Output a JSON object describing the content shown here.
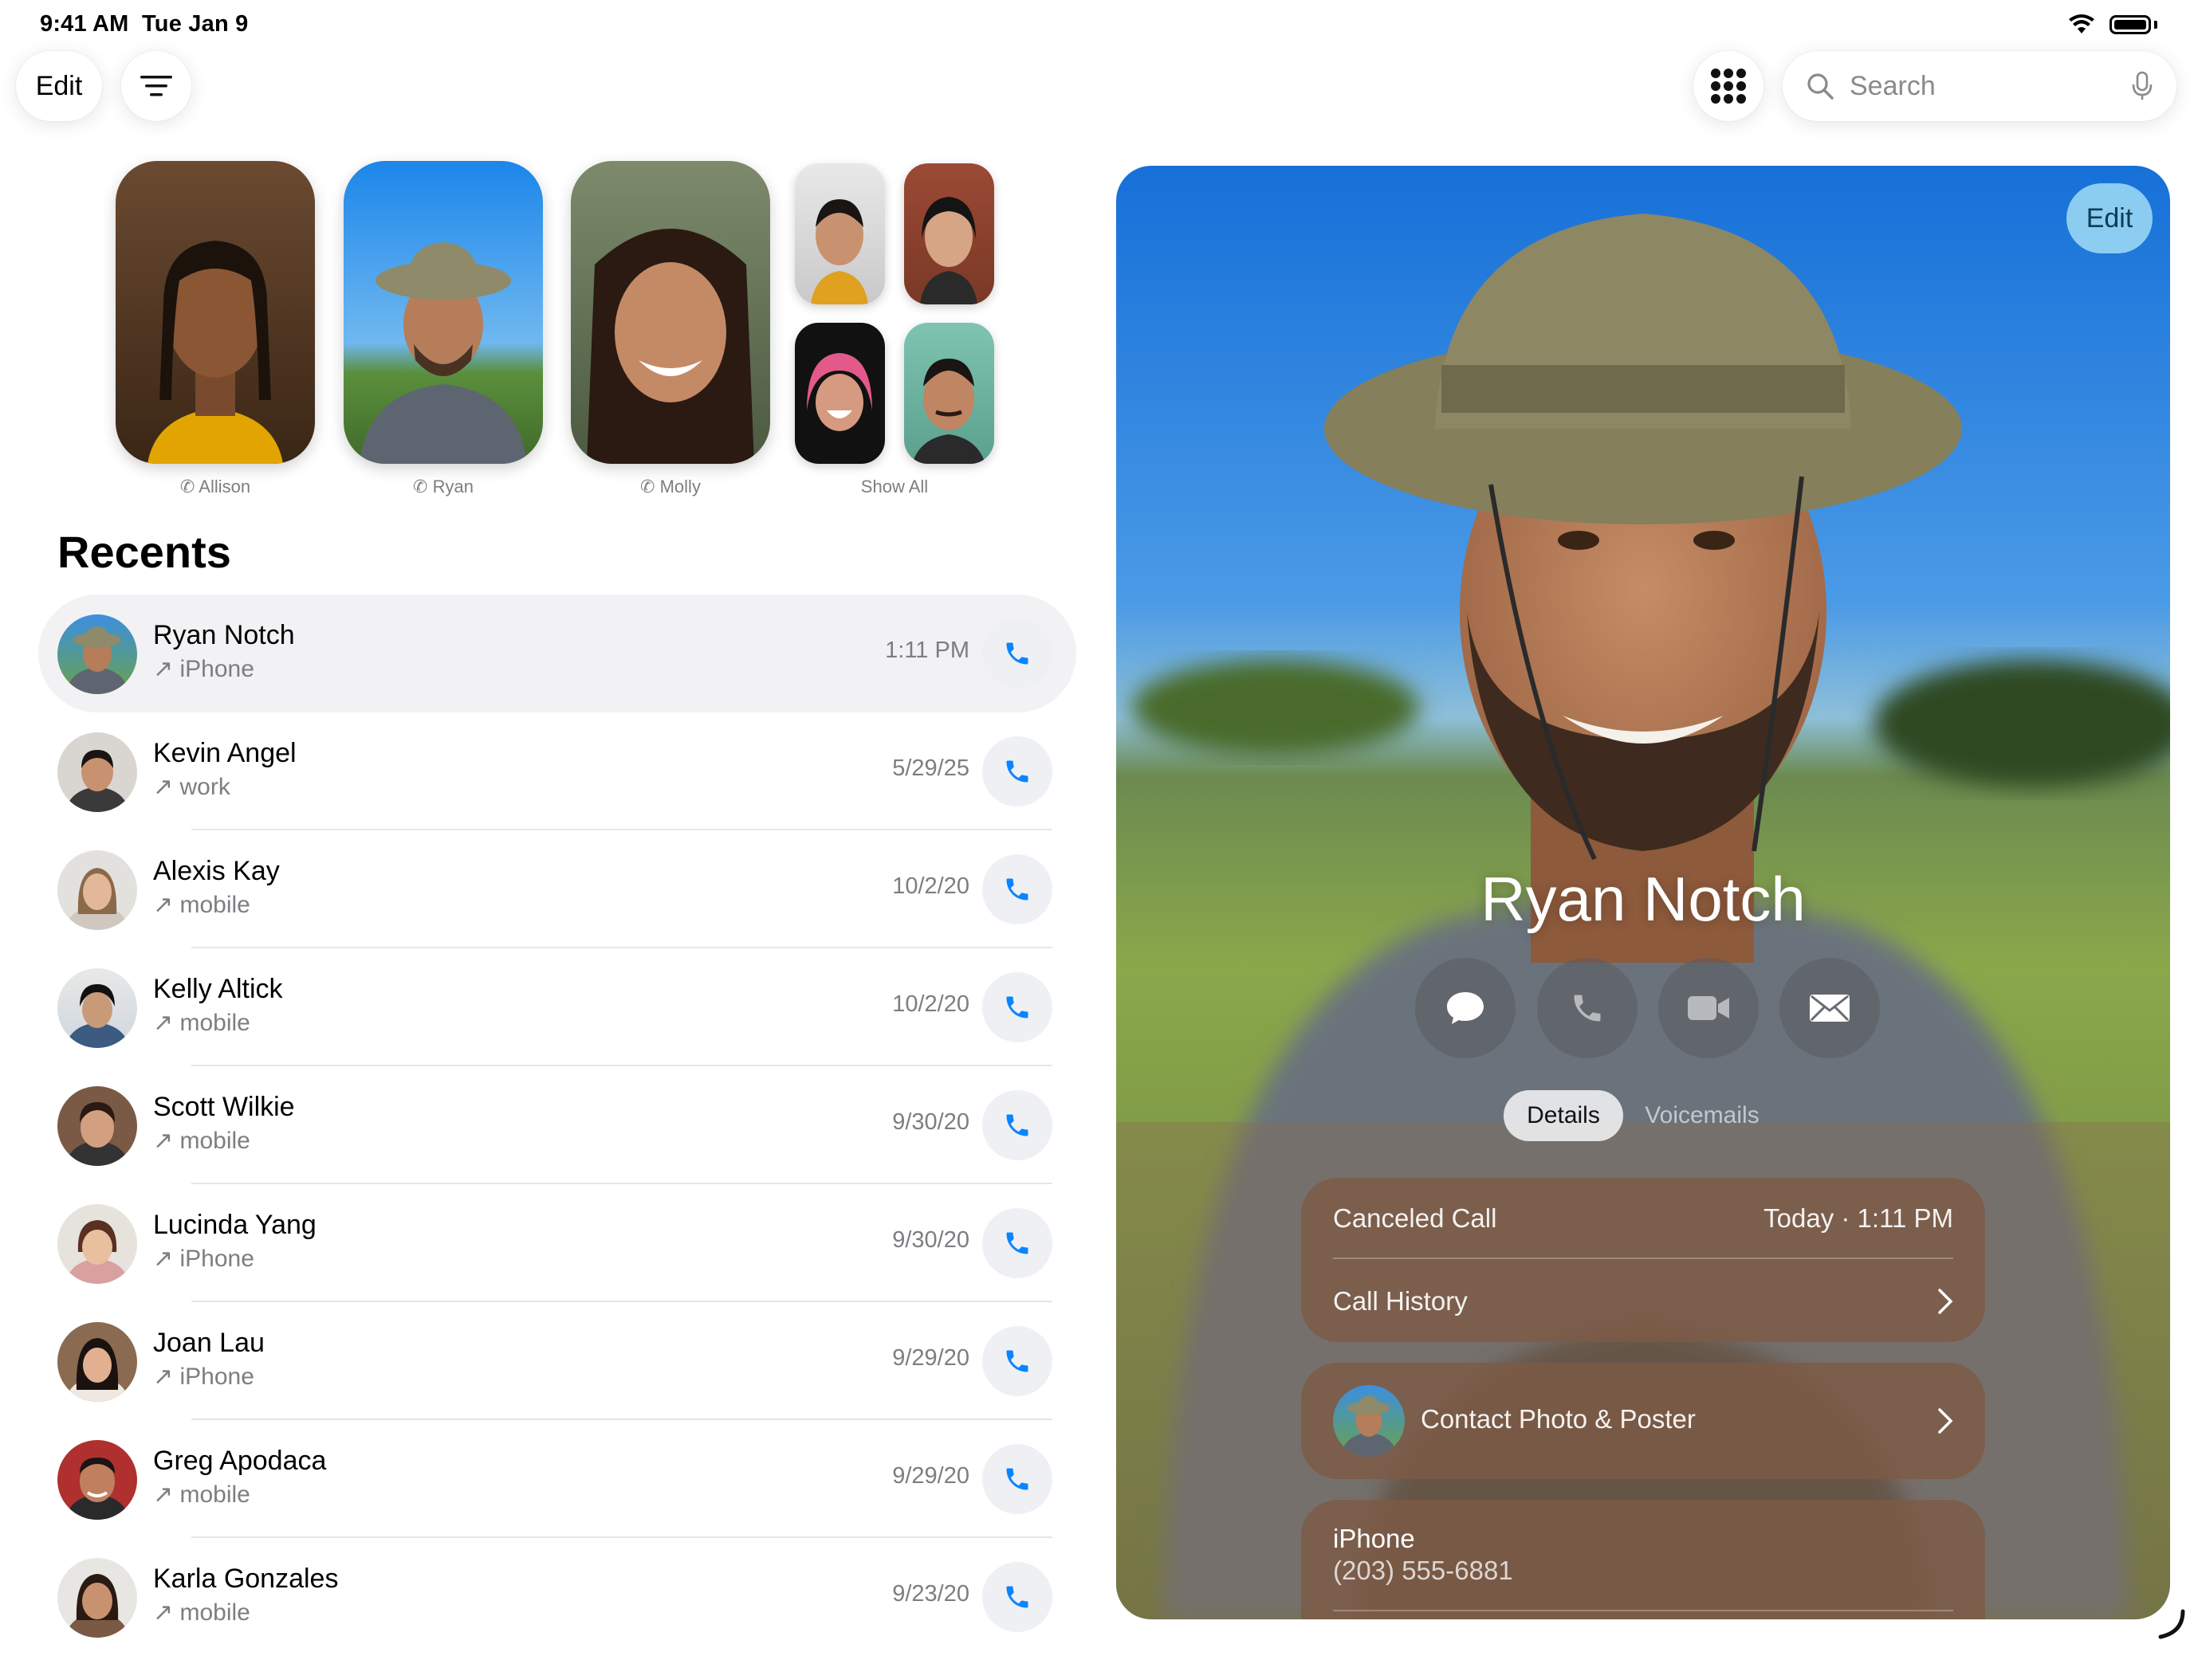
{
  "status": {
    "time": "9:41 AM",
    "date": "Tue Jan 9"
  },
  "toolbar": {
    "edit_label": "Edit",
    "search_placeholder": "Search"
  },
  "favorites": [
    {
      "name": "Allison"
    },
    {
      "name": "Ryan"
    },
    {
      "name": "Molly"
    }
  ],
  "show_all_label": "Show All",
  "recents": {
    "title": "Recents",
    "items": [
      {
        "name": "Ryan Notch",
        "type": "iPhone",
        "time": "1:11 PM"
      },
      {
        "name": "Kevin Angel",
        "type": "work",
        "time": "5/29/25"
      },
      {
        "name": "Alexis Kay",
        "type": "mobile",
        "time": "10/2/20"
      },
      {
        "name": "Kelly Altick",
        "type": "mobile",
        "time": "10/2/20"
      },
      {
        "name": "Scott Wilkie",
        "type": "mobile",
        "time": "9/30/20"
      },
      {
        "name": "Lucinda Yang",
        "type": "iPhone",
        "time": "9/30/20"
      },
      {
        "name": "Joan Lau",
        "type": "iPhone",
        "time": "9/29/20"
      },
      {
        "name": "Greg Apodaca",
        "type": "mobile",
        "time": "9/29/20"
      },
      {
        "name": "Karla Gonzales",
        "type": "mobile",
        "time": "9/23/20"
      }
    ]
  },
  "detail": {
    "edit_label": "Edit",
    "name": "Ryan Notch",
    "tabs": {
      "details": "Details",
      "voicemails": "Voicemails"
    },
    "call_status": "Canceled Call",
    "call_time": "Today · 1:11 PM",
    "call_history": "Call History",
    "contact_photo": "Contact Photo & Poster",
    "phone_label": "iPhone",
    "phone_number": "(203) 555-6881"
  },
  "colors": {
    "accent": "#0a84ff"
  }
}
